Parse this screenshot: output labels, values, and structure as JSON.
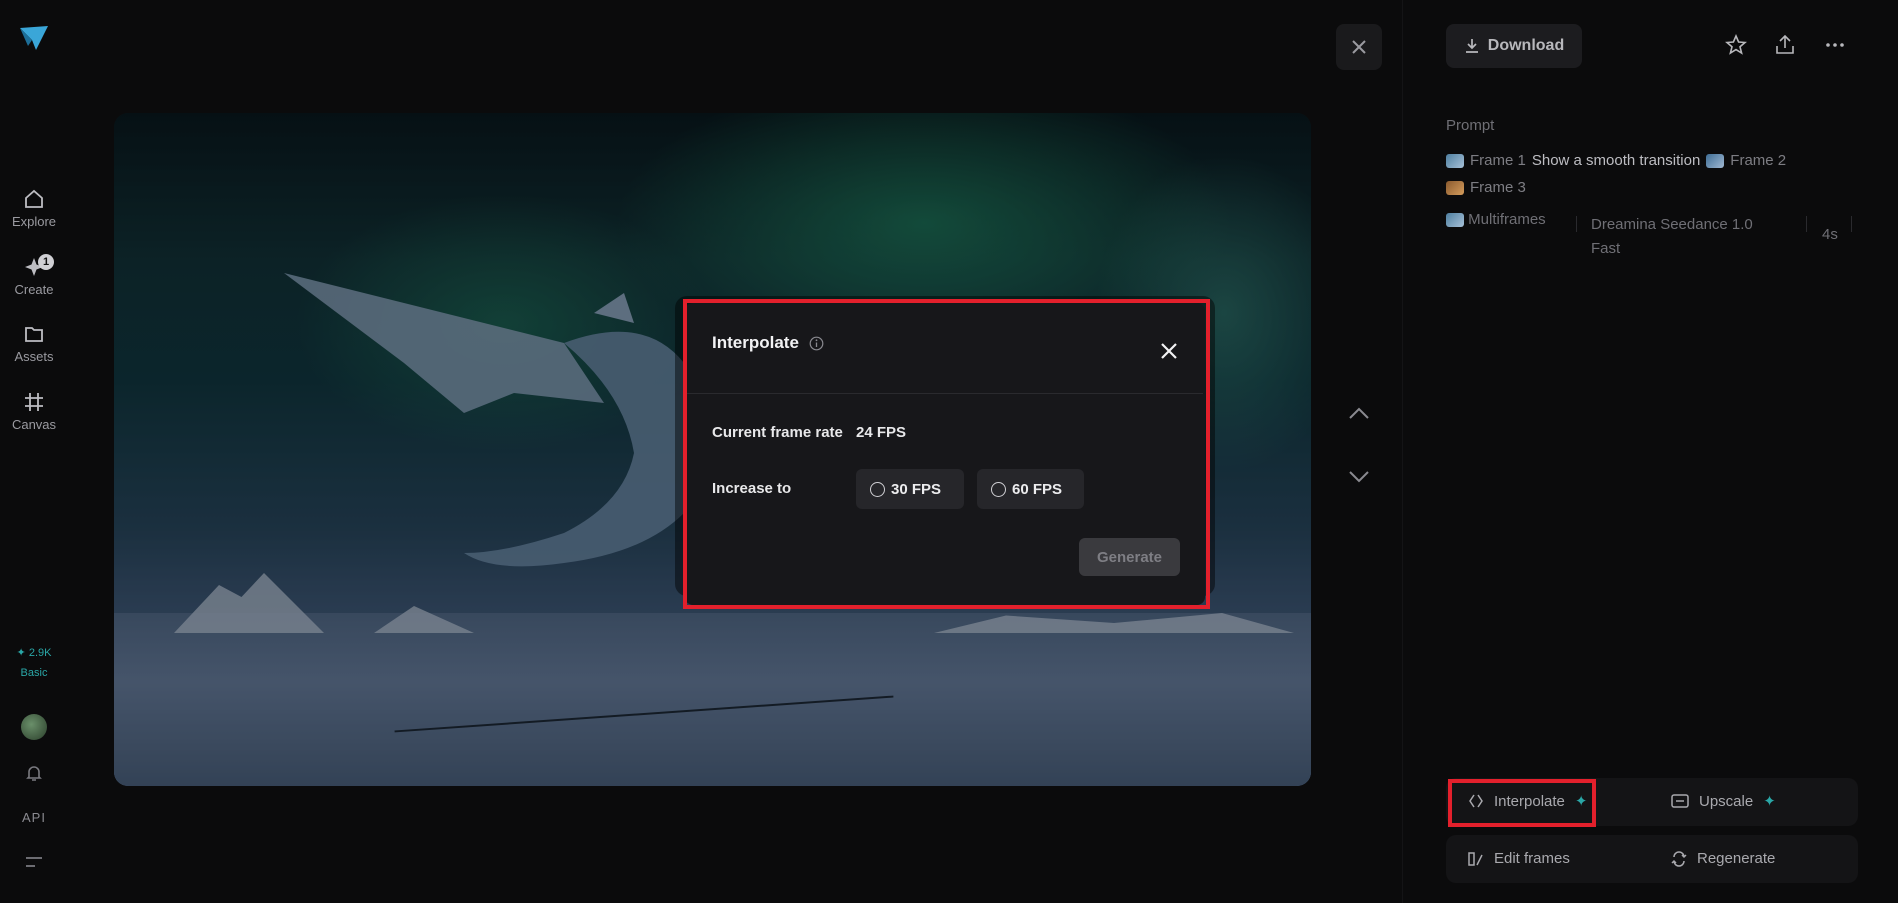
{
  "nav": {
    "items": [
      {
        "label": "Explore",
        "icon": "home-icon"
      },
      {
        "label": "Create",
        "icon": "create-icon",
        "badge": "1"
      },
      {
        "label": "Assets",
        "icon": "folder-icon"
      },
      {
        "label": "Canvas",
        "icon": "canvas-icon"
      }
    ],
    "credits": "✦ 2.9K",
    "plan": "Basic",
    "api_label": "API"
  },
  "toolbar": {
    "download_label": "Download"
  },
  "prompt": {
    "label": "Prompt",
    "frame1": "Frame 1",
    "text": "Show a smooth transition",
    "frame2": "Frame 2",
    "frame3": "Frame 3"
  },
  "meta": {
    "mode": "Multiframes",
    "model_line1": "Dreamina Seedance 1.0",
    "model_line2": "Fast",
    "duration": "4s"
  },
  "actions": {
    "interpolate": "Interpolate",
    "upscale": "Upscale",
    "edit_frames": "Edit frames",
    "regenerate": "Regenerate"
  },
  "dialog": {
    "title": "Interpolate",
    "current_label": "Current frame rate",
    "current_value": "24 FPS",
    "increase_label": "Increase to",
    "options": [
      "30 FPS",
      "60 FPS"
    ],
    "generate_label": "Generate"
  },
  "colors": {
    "accent": "#2aa7a7",
    "highlight": "#e3202c"
  }
}
